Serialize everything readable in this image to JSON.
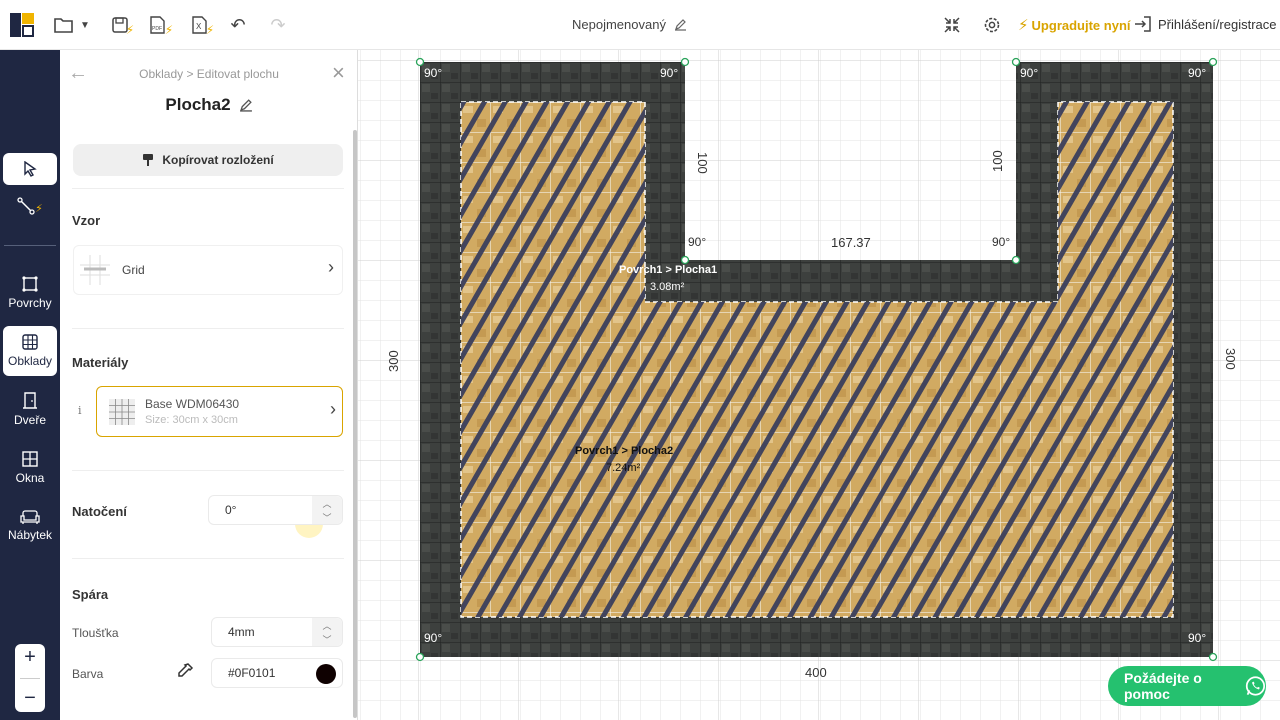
{
  "topbar": {
    "title": "Nepojmenovaný",
    "upgrade_label": "Upgradujte nyní",
    "login_label": "Přihlášení/registrace"
  },
  "nav": {
    "items": [
      {
        "label": "Povrchy",
        "icon": "surfaces-icon"
      },
      {
        "label": "Obklady",
        "icon": "tiles-icon"
      },
      {
        "label": "Dveře",
        "icon": "door-icon"
      },
      {
        "label": "Okna",
        "icon": "window-icon"
      },
      {
        "label": "Nábytek",
        "icon": "sofa-icon"
      }
    ],
    "zoom_in": "+",
    "zoom_out": "−"
  },
  "panel": {
    "breadcrumb": "Obklady > Editovat plochu",
    "area_name": "Plocha2",
    "copy_layout_label": "Kopírovat rozložení",
    "pattern_section": "Vzor",
    "pattern_value": "Grid",
    "materials_section": "Materiály",
    "material_name": "Base WDM06430",
    "material_size": "Size: 30cm x 30cm",
    "info_label": "i",
    "rotation_label": "Natočení",
    "rotation_value": "0°",
    "joint_section": "Spára",
    "thickness_label": "Tloušťka",
    "thickness_value": "4mm",
    "color_label": "Barva",
    "color_value": "#0F0101"
  },
  "canvas": {
    "dim_top_center": "167.37",
    "dim_left_notch": "100",
    "dim_right_notch": "100",
    "dim_left": "300",
    "dim_right": "300",
    "dim_bottom": "400",
    "angle_label": "90°",
    "area1_name": "Povrch1 > Plocha1",
    "area1_size": "3.08m²",
    "area2_name": "Povrch1 > Plocha2",
    "area2_size": "7.24m²"
  },
  "help": {
    "label": "Požádejte o pomoc"
  },
  "colors": {
    "nav_bg": "#1f2742",
    "accent_gold": "#d9a400",
    "help_green": "#25c16f",
    "wall_tile": "#3d403e",
    "floor_tile": "#d1aa62",
    "stripe": "#3b3f5c"
  }
}
